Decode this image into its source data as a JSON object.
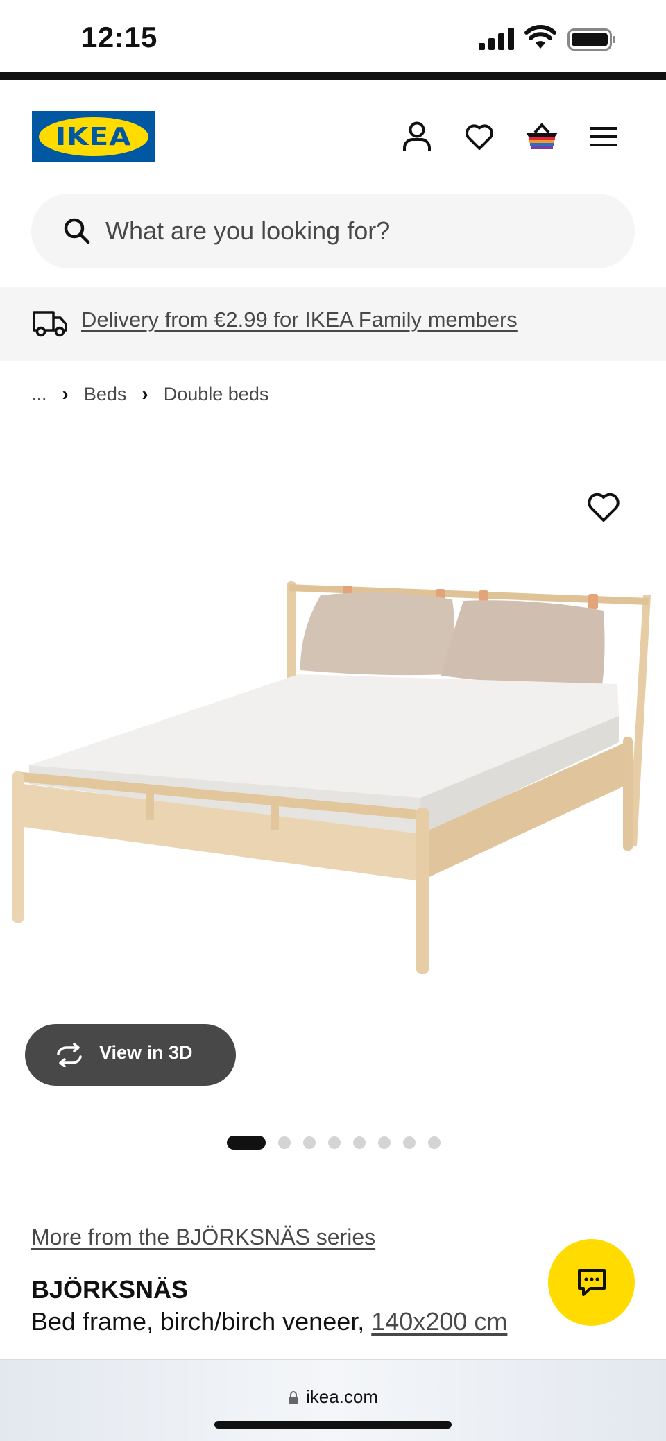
{
  "status_bar": {
    "time": "12:15"
  },
  "header": {
    "logo_text": "IKEA",
    "icons": [
      "account-icon",
      "favourites-icon",
      "shopping-bag-icon",
      "menu-icon"
    ]
  },
  "search": {
    "placeholder": "What are you looking for?"
  },
  "delivery_banner": {
    "text": "Delivery from €2.99 for IKEA Family members",
    "icon": "truck-icon"
  },
  "breadcrumb": {
    "ellipsis": "...",
    "items": [
      "Beds",
      "Double beds"
    ]
  },
  "gallery": {
    "view_3d_label": "View in 3D",
    "image_count": 8,
    "active_index": 0
  },
  "product": {
    "series_link": "More from the BJÖRKSNÄS series",
    "name": "BJÖRKSNÄS",
    "description": "Bed frame, birch/birch veneer,",
    "size": "140x200 cm"
  },
  "browser": {
    "url": "ikea.com"
  },
  "colors": {
    "brand_blue": "#0058a3",
    "brand_yellow": "#ffdb00",
    "text_dark": "#111111",
    "text_grey": "#484848",
    "surface_grey": "#f5f5f5"
  }
}
